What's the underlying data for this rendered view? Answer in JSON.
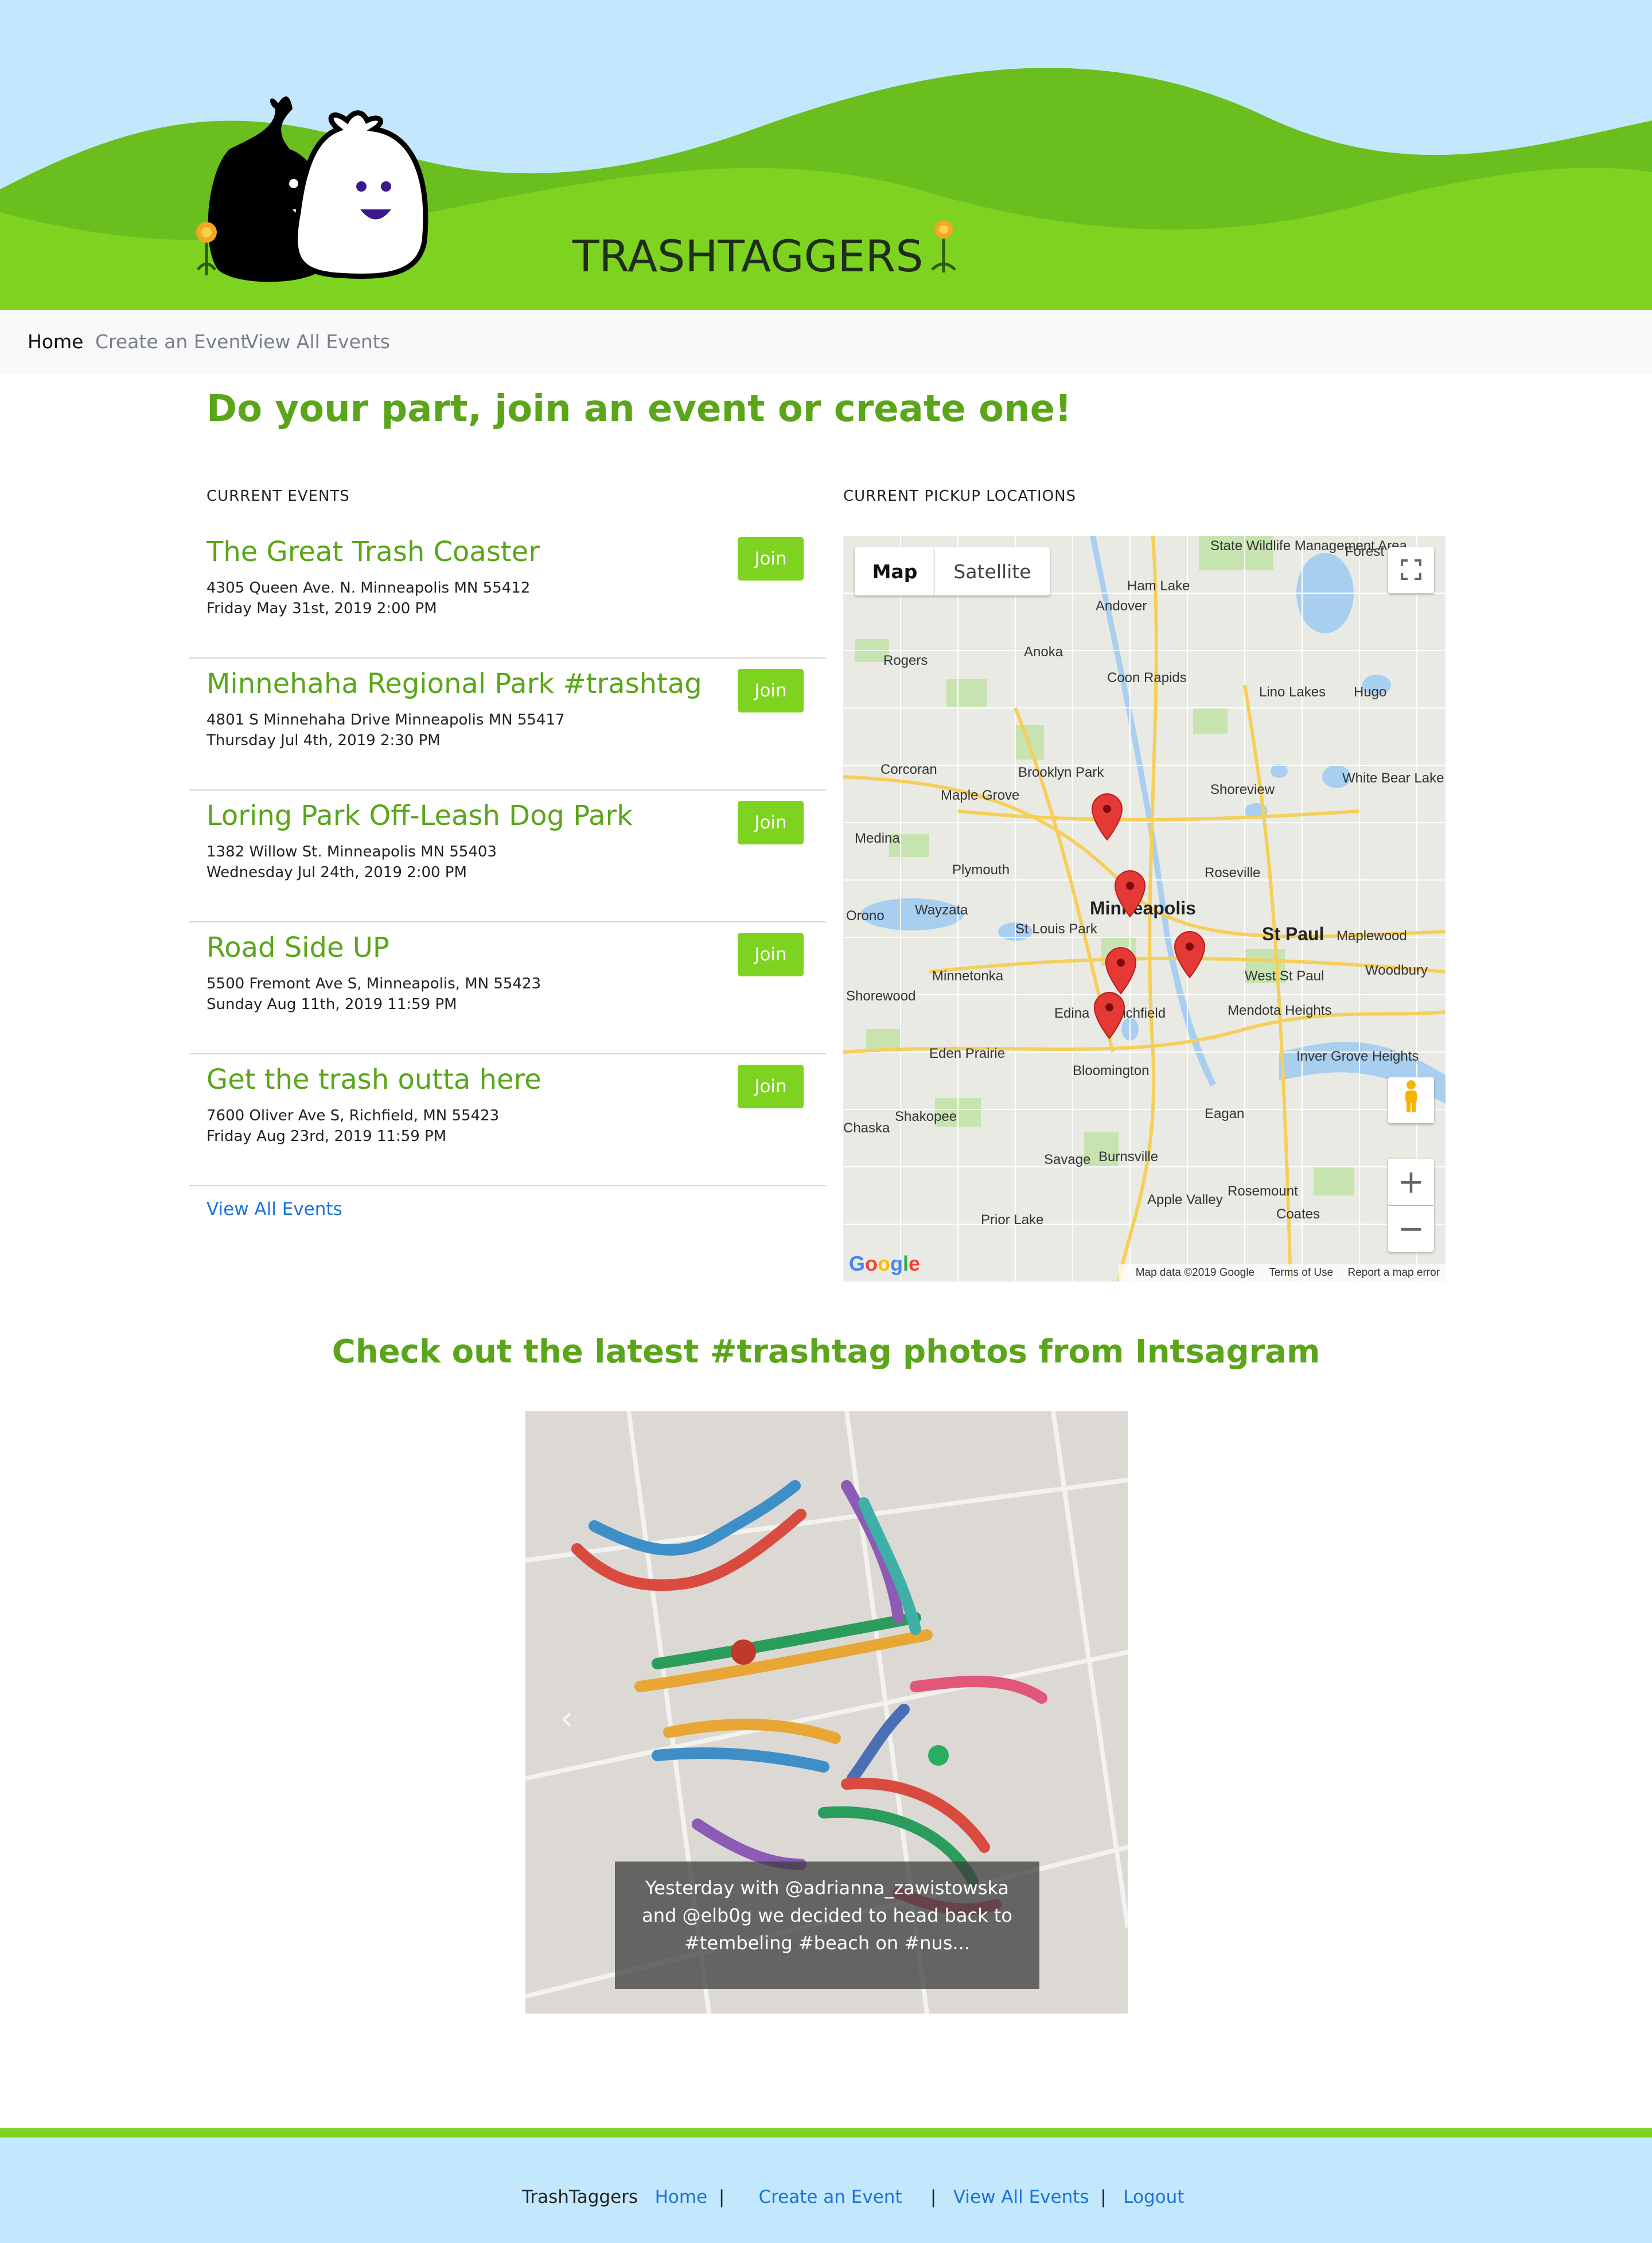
{
  "site": {
    "title": "TRASHTAGGERS"
  },
  "nav": {
    "home": "Home",
    "create": "Create an Event",
    "view_all": "View All Events"
  },
  "main": {
    "headline": "Do your part, join an event or create one!",
    "events_label": "CURRENT EVENTS",
    "map_label": "CURRENT PICKUP LOCATIONS",
    "view_all_link": "View All Events",
    "join_label": "Join",
    "events": [
      {
        "title": "The Great Trash Coaster",
        "address": "4305 Queen Ave. N. Minneapolis MN 55412",
        "date": "Friday May 31st, 2019 2:00 PM"
      },
      {
        "title": "Minnehaha Regional Park #trashtag",
        "address": "4801 S Minnehaha Drive Minneapolis MN 55417",
        "date": "Thursday Jul 4th, 2019 2:30 PM"
      },
      {
        "title": "Loring Park Off-Leash Dog Park",
        "address": "1382 Willow St. Minneapolis MN 55403",
        "date": "Wednesday Jul 24th, 2019 2:00 PM"
      },
      {
        "title": "Road Side UP",
        "address": "5500 Fremont Ave S, Minneapolis, MN 55423",
        "date": "Sunday Aug 11th, 2019 11:59 PM"
      },
      {
        "title": "Get the trash outta here",
        "address": "7600 Oliver Ave S, Richfield, MN 55423",
        "date": "Friday Aug 23rd, 2019 11:59 PM"
      }
    ]
  },
  "map": {
    "type_map": "Map",
    "type_satellite": "Satellite",
    "logo": "Google",
    "footer_data": "Map data ©2019 Google",
    "footer_terms": "Terms of Use",
    "footer_report": "Report a map error",
    "zoom_in": "+",
    "zoom_out": "−",
    "places": [
      "Anoka",
      "Coon Rapids",
      "Ham Lake",
      "Andover",
      "Rogers",
      "Lino Lakes",
      "Hugo",
      "Brooklyn Park",
      "Corcoran",
      "Maple Grove",
      "Shoreview",
      "White Bear Lake",
      "Medina",
      "Plymouth",
      "Roseville",
      "Orono",
      "Wayzata",
      "St Louis Park",
      "Minneapolis",
      "St Paul",
      "Maplewood",
      "Minnetonka",
      "Woodbury",
      "Shorewood",
      "Edina",
      "Richfield",
      "West St Paul",
      "Mendota Heights",
      "Eden Prairie",
      "Bloomington",
      "Inver Grove Heights",
      "Eagan",
      "Chaska",
      "Shakopee",
      "Savage",
      "Burnsville",
      "Rosemount",
      "Apple Valley",
      "Prior Lake",
      "Coates",
      "Forest Lake",
      "State Wildlife Management Area"
    ],
    "pins": 5
  },
  "instagram": {
    "heading": "Check out the latest #trashtag photos from Intsagram",
    "caption": "Yesterday with @adrianna_zawistowska and @elb0g we decided to head back to #tembeling #beach on #nus..."
  },
  "footer": {
    "brand": "TrashTaggers",
    "home": "Home",
    "create": "Create an Event",
    "view_all": "View All Events",
    "logout": "Logout"
  },
  "colors": {
    "accent": "#7ed321",
    "headline": "#5aa51a",
    "sky": "#c3e7fc",
    "link": "#1a73d9"
  }
}
